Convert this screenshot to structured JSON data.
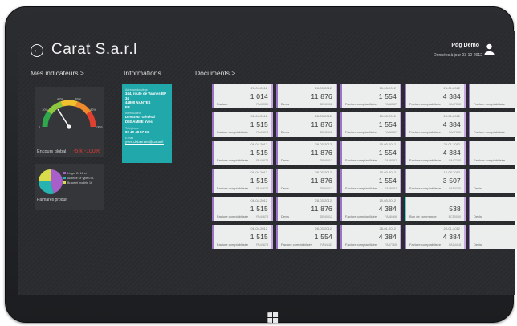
{
  "header": {
    "title": "Carat S.a.r.l",
    "user_name": "Pdg Demo",
    "user_subtitle": "Données à jour 03-10-2012"
  },
  "sections": {
    "indicators": "Mes indicateurs >",
    "informations": "Informations",
    "documents": "Documents >"
  },
  "gauge": {
    "label": "Encours global",
    "value_text": "-5 k -100%",
    "needle_fraction": 0.32,
    "tick_labels": [
      "0",
      "20%",
      "40%",
      "60%",
      "80%",
      "100%"
    ]
  },
  "pie": {
    "legend": [
      "Lingot Or 18 ct",
      "Alliance Or type 073",
      "Bracelet modèle 16"
    ],
    "caption": "Palmares produit",
    "slices": [
      {
        "value": 0.46,
        "color": "#a85fc9"
      },
      {
        "value": 0.3,
        "color": "#27b3b0"
      },
      {
        "value": 0.24,
        "color": "#d9dc4a"
      }
    ]
  },
  "info": {
    "siege_key": "Adresse du siège",
    "siege_lines": [
      "344, route de Vannes BP",
      "34",
      "44800 NANTES",
      "FR"
    ],
    "interlocuteur_key": "Interlocuteur",
    "interlocuteur_lines": [
      "Directeur Général",
      "DEBAMME Yves"
    ],
    "telephone_key": "Téléphone",
    "telephone": "02 40 48 67 01",
    "email_key": "E-mail",
    "email": "yves.debamme@carat.fr"
  },
  "documents": [
    {
      "date": "21-09-2012",
      "amount": "1 014",
      "type": "Facture",
      "num": "FA49050",
      "mint": false
    },
    {
      "date": "28-03-2012",
      "amount": "11 876",
      "type": "Devis",
      "num": "DE40012",
      "mint": false
    },
    {
      "date": "10-03-2012",
      "amount": "1 554",
      "type": "Facture comptabilisée",
      "num": "FA48187",
      "mint": false
    },
    {
      "date": "28-01-2012",
      "amount": "4 384",
      "type": "Facture comptabilisée",
      "num": "FA47365",
      "mint": false
    },
    {
      "date": "",
      "amount": "",
      "type": "Facture comptabilisée",
      "num": "",
      "mint": false
    },
    {
      "date": "06-04-2012",
      "amount": "1 515",
      "type": "Facture comptabilisée",
      "num": "FA44678",
      "mint": false
    },
    {
      "date": "28-03-2012",
      "amount": "11 876",
      "type": "Devis",
      "num": "DE40012",
      "mint": false
    },
    {
      "date": "10-03-2012",
      "amount": "1 554",
      "type": "Facture comptabilisée",
      "num": "FA48187",
      "mint": false
    },
    {
      "date": "28-01-2012",
      "amount": "4 384",
      "type": "Facture comptabilisée",
      "num": "FA47365",
      "mint": false
    },
    {
      "date": "",
      "amount": "",
      "type": "Facture comptabilisée",
      "num": "",
      "mint": false
    },
    {
      "date": "06-04-2012",
      "amount": "1 515",
      "type": "Facture comptabilisée",
      "num": "FA44678",
      "mint": false
    },
    {
      "date": "28-03-2012",
      "amount": "11 876",
      "type": "Devis",
      "num": "DE40012",
      "mint": false
    },
    {
      "date": "10-03-2012",
      "amount": "1 554",
      "type": "Facture comptabilisée",
      "num": "FA48187",
      "mint": false
    },
    {
      "date": "28-01-2012",
      "amount": "4 384",
      "type": "Facture comptabilisée",
      "num": "FA47365",
      "mint": false
    },
    {
      "date": "",
      "amount": "",
      "type": "Facture comptabilisée",
      "num": "",
      "mint": false
    },
    {
      "date": "06-04-2012",
      "amount": "1 515",
      "type": "Facture comptabilisée",
      "num": "FA44678",
      "mint": false
    },
    {
      "date": "28-03-2012",
      "amount": "11 876",
      "type": "Devis",
      "num": "DE40012",
      "mint": false
    },
    {
      "date": "10-03-2012",
      "amount": "1 554",
      "type": "Facture comptabilisée",
      "num": "FA48187",
      "mint": false
    },
    {
      "date": "14-08-2012",
      "amount": "3 507",
      "type": "Facture comptabilisée",
      "num": "FA50370",
      "mint": false
    },
    {
      "date": "",
      "amount": "",
      "type": "Devis",
      "num": "",
      "mint": false
    },
    {
      "date": "06-04-2012",
      "amount": "1 515",
      "type": "Facture comptabilisée",
      "num": "FA44678",
      "mint": false
    },
    {
      "date": "28-03-2012",
      "amount": "11 876",
      "type": "Devis",
      "num": "DE40012",
      "mint": false
    },
    {
      "date": "10-03-2012",
      "amount": "4 384",
      "type": "Facture comptabilisée",
      "num": "FA48466",
      "mint": false
    },
    {
      "date": "",
      "amount": "538",
      "type": "Bon de commande",
      "num": "BC50050",
      "mint": true
    },
    {
      "date": "",
      "amount": "",
      "type": "Devis",
      "num": "",
      "mint": false
    },
    {
      "date": "06-04-2012",
      "amount": "1 515",
      "type": "Facture comptabilisée",
      "num": "FA44678",
      "mint": false
    },
    {
      "date": "28-03-2012",
      "amount": "1 554",
      "type": "Facture comptabilisée",
      "num": "FA44187",
      "mint": false
    },
    {
      "date": "28-01-2012",
      "amount": "4 384",
      "type": "Facture comptabilisée",
      "num": "FA47365",
      "mint": false
    },
    {
      "date": "28-01-2012",
      "amount": "4 384",
      "type": "Facture comptabilisée",
      "num": "FA24418",
      "mint": false
    },
    {
      "date": "",
      "amount": "",
      "type": "Devis",
      "num": "",
      "mint": false
    }
  ]
}
